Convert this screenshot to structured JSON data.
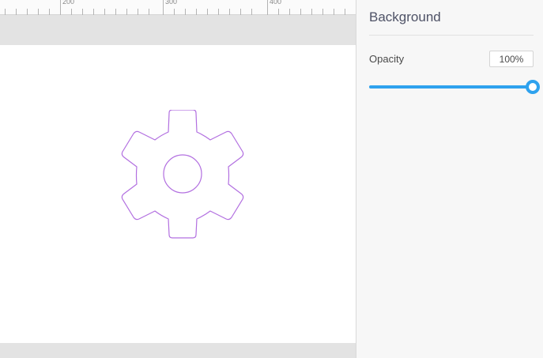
{
  "ruler": {
    "labels": [
      "200",
      "300",
      "400"
    ]
  },
  "canvas": {
    "icon": "gear-icon",
    "icon_color": "#b26fe0"
  },
  "panel": {
    "title": "Background",
    "opacity_label": "Opacity",
    "opacity_value": "100%",
    "opacity_fraction": 1.0,
    "accent_color": "#2ea2ee"
  }
}
